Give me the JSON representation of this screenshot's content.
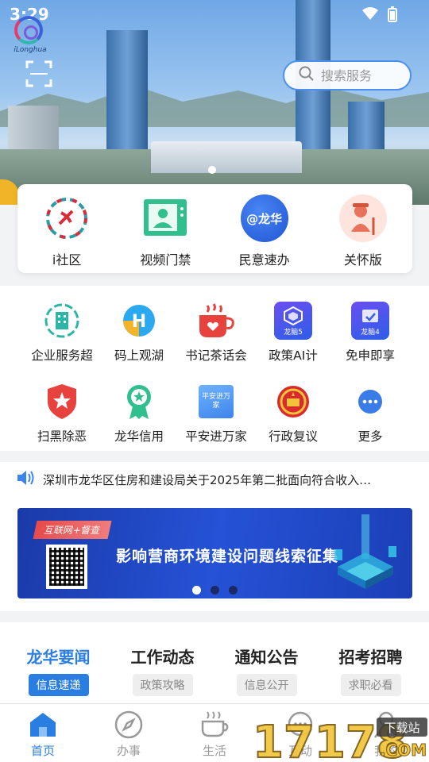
{
  "status_bar": {
    "time": "3:29"
  },
  "logo": {
    "brand_text": "iLonghua"
  },
  "search": {
    "placeholder": "搜索服务"
  },
  "quick_access": [
    {
      "label": "i社区",
      "icon": "community-emblem-icon"
    },
    {
      "label": "视频门禁",
      "icon": "video-access-icon"
    },
    {
      "label": "民意速办",
      "icon": "public-opinion-icon",
      "badge": "@龙华"
    },
    {
      "label": "关怀版",
      "icon": "elder-care-icon"
    }
  ],
  "services": [
    {
      "label": "企业服务超",
      "icon": "enterprise-building-icon"
    },
    {
      "label": "码上观湖",
      "icon": "h-logo-icon"
    },
    {
      "label": "书记茶话会",
      "icon": "tea-cup-icon"
    },
    {
      "label": "政策AI计",
      "icon": "policy-ai-icon",
      "badge": "龙脑5"
    },
    {
      "label": "免申即享",
      "icon": "apply-free-icon",
      "badge": "龙脑4"
    },
    {
      "label": "扫黑除恶",
      "icon": "shield-star-icon"
    },
    {
      "label": "龙华信用",
      "icon": "credit-medal-icon"
    },
    {
      "label": "平安进万家",
      "icon": "safety-home-icon",
      "badge": "平安进万家"
    },
    {
      "label": "行政复议",
      "icon": "national-emblem-icon"
    },
    {
      "label": "更多",
      "icon": "more-icon"
    }
  ],
  "notice": {
    "text": "深圳市龙华区住房和建设局关于2025年第二批面向符合收入…"
  },
  "banner": {
    "tag": "互联网+督查",
    "title": "影响营商环境建设问题线索征集",
    "active_slide": 1,
    "total_slides": 3
  },
  "news_tabs": [
    {
      "title": "龙华要闻",
      "sub": "信息速递",
      "active": true
    },
    {
      "title": "工作动态",
      "sub": "政策攻略",
      "active": false
    },
    {
      "title": "通知公告",
      "sub": "信息公开",
      "active": false
    },
    {
      "title": "招考招聘",
      "sub": "求职必看",
      "active": false
    }
  ],
  "bottom_nav": [
    {
      "label": "首页",
      "icon": "home-icon",
      "active": true
    },
    {
      "label": "办事",
      "icon": "compass-icon",
      "active": false
    },
    {
      "label": "生活",
      "icon": "coffee-icon",
      "active": false
    },
    {
      "label": "互动",
      "icon": "chat-icon",
      "active": false
    },
    {
      "label": "我的",
      "icon": "user-icon",
      "active": false
    }
  ],
  "watermark": {
    "text": "17178",
    "sub": "下载站",
    "suffix": ".COM"
  },
  "colors": {
    "accent": "#2a7de1",
    "search_border": "#4b8ff0"
  }
}
